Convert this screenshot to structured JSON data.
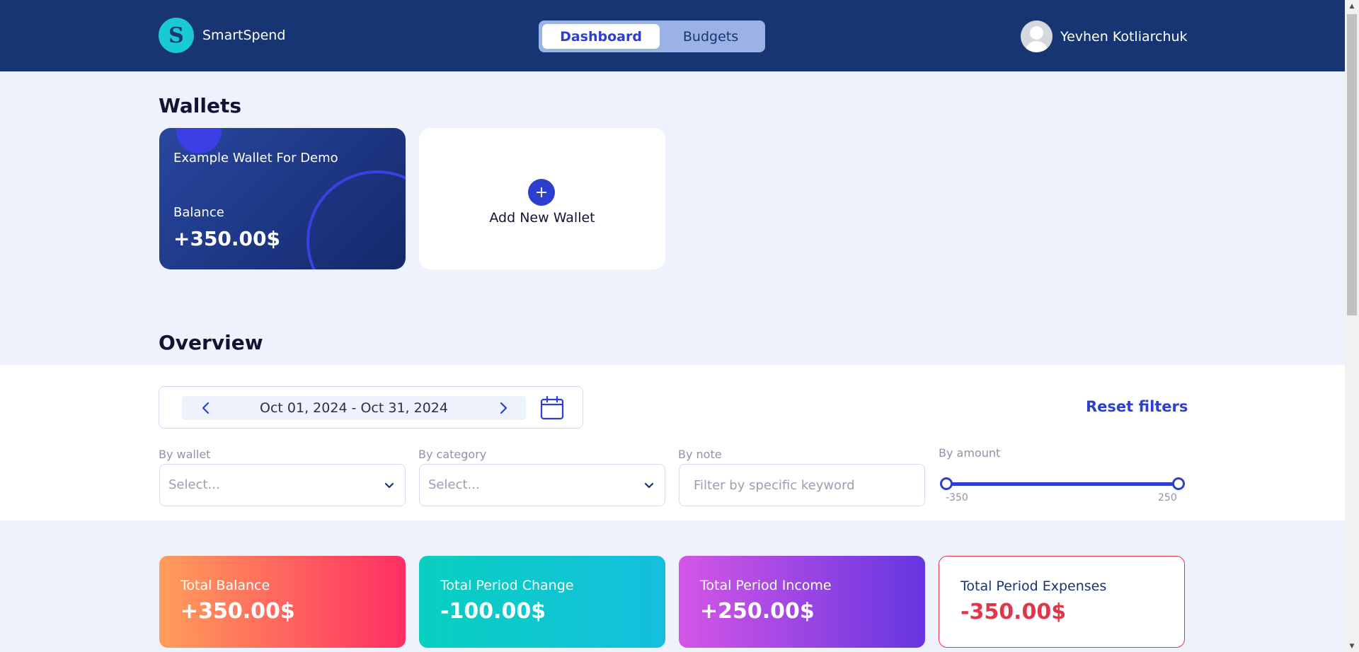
{
  "app": {
    "name": "SmartSpend",
    "logo_letter": "S"
  },
  "nav": {
    "tabs": [
      {
        "label": "Dashboard",
        "active": true
      },
      {
        "label": "Budgets",
        "active": false
      }
    ]
  },
  "user": {
    "name": "Yevhen Kotliarchuk"
  },
  "wallets": {
    "title": "Wallets",
    "items": [
      {
        "name": "Example Wallet For Demo",
        "balance_label": "Balance",
        "balance": "+350.00$"
      }
    ],
    "add_label": "Add New Wallet",
    "add_icon": "+"
  },
  "overview": {
    "title": "Overview",
    "date_range": "Oct 01, 2024 - Oct 31, 2024",
    "reset_label": "Reset filters",
    "filters": {
      "wallet": {
        "label": "By wallet",
        "placeholder": "Select..."
      },
      "category": {
        "label": "By category",
        "placeholder": "Select..."
      },
      "note": {
        "label": "By note",
        "placeholder": "Filter by specific keyword"
      },
      "amount": {
        "label": "By amount",
        "min_label": "-350",
        "max_label": "250",
        "min": -350,
        "max": 250,
        "value_low": -350,
        "value_high": 250
      }
    }
  },
  "stats": [
    {
      "label": "Total Balance",
      "value": "+350.00$"
    },
    {
      "label": "Total Period Change",
      "value": "-100.00$"
    },
    {
      "label": "Total Period Income",
      "value": "+250.00$"
    },
    {
      "label": "Total Period Expenses",
      "value": "-350.00$"
    }
  ],
  "colors": {
    "header": "#173473",
    "accent": "#2e3fd0",
    "background": "#edf2fd",
    "expense": "#e0354a"
  }
}
